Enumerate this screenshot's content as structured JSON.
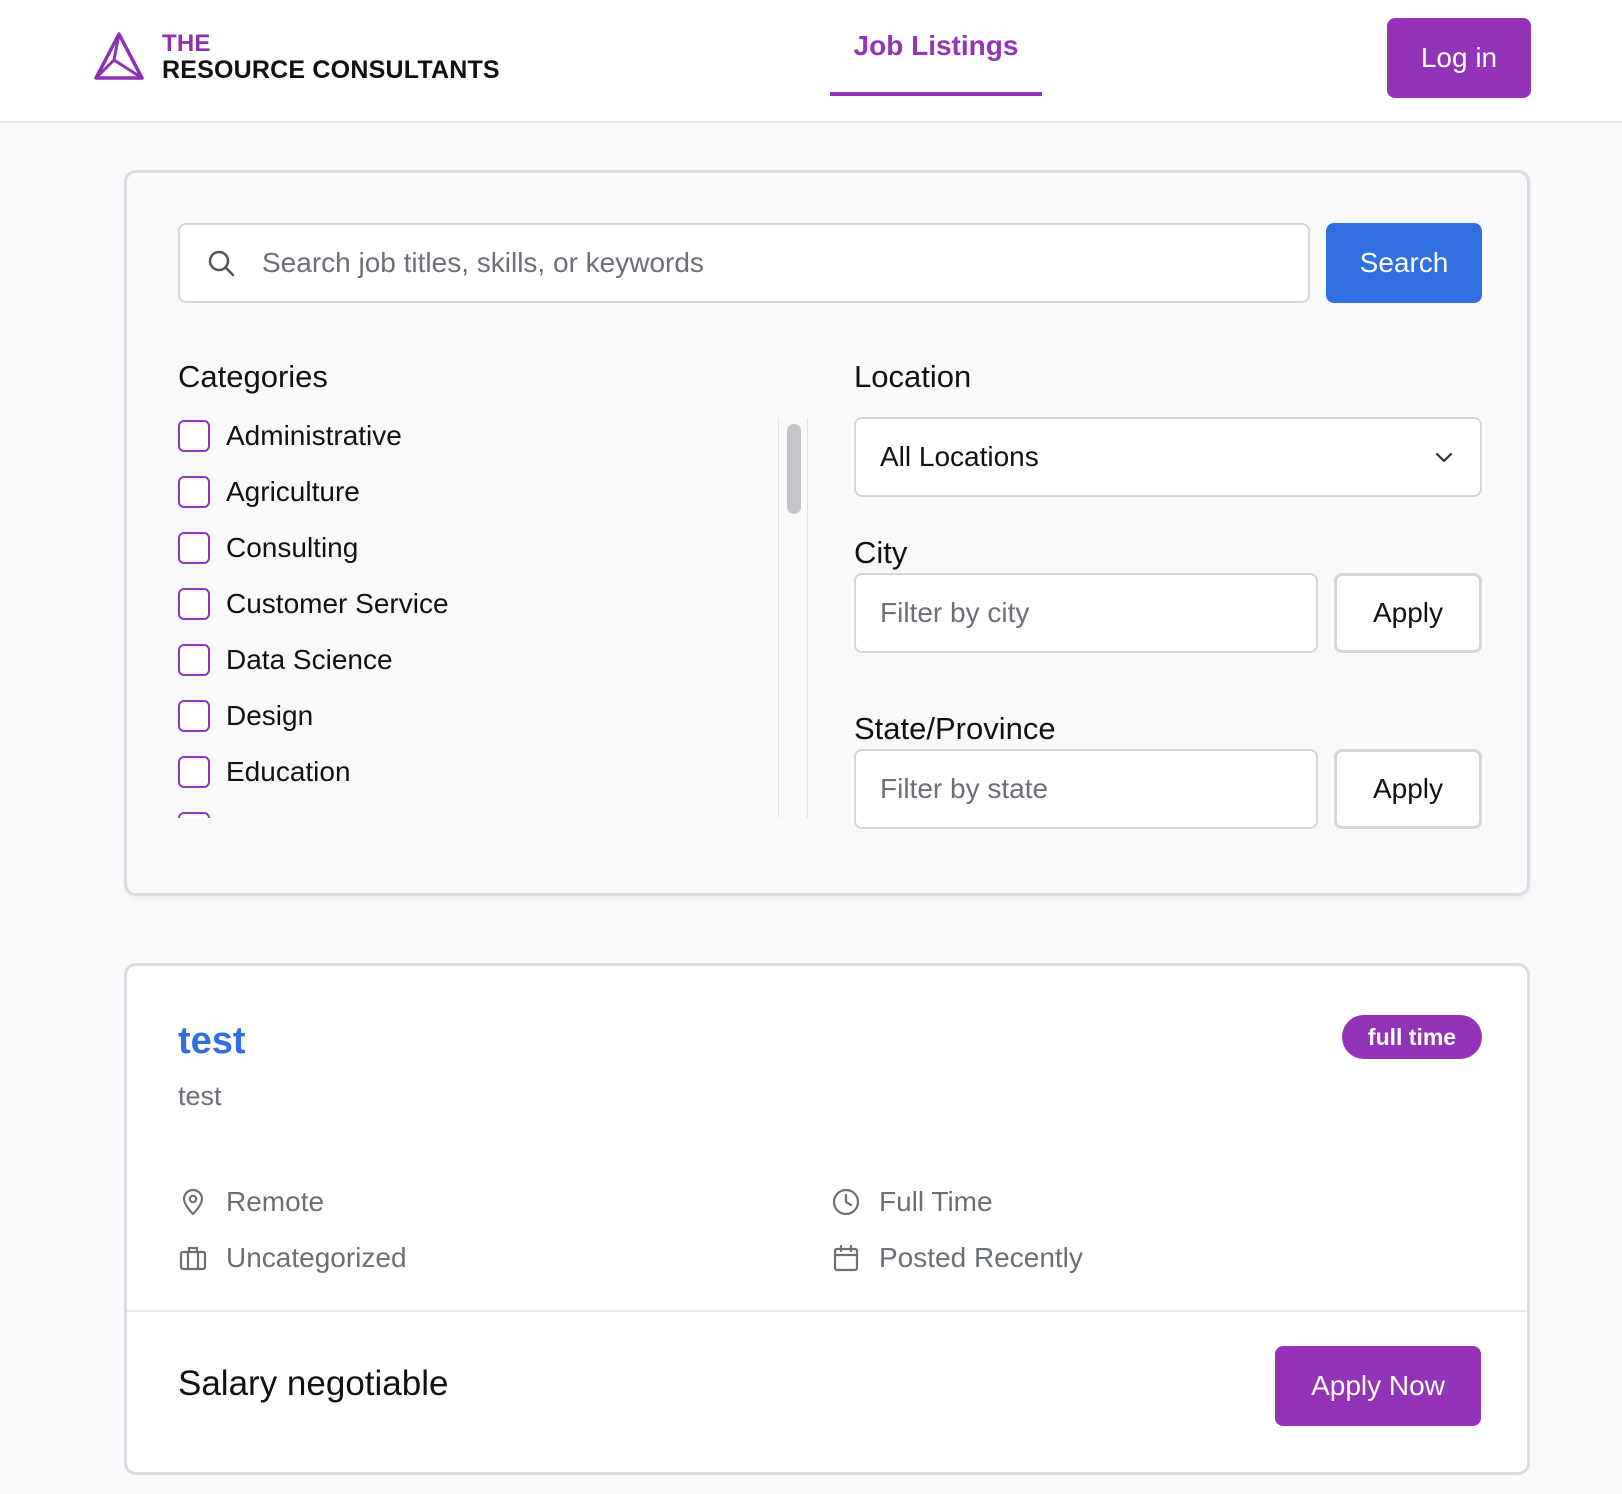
{
  "header": {
    "logo_line1": "THE",
    "logo_line2": "RESOURCE CONSULTANTS",
    "nav_tab": "Job Listings",
    "login_label": "Log in"
  },
  "search": {
    "placeholder": "Search job titles, skills, or keywords",
    "value": "",
    "button_label": "Search"
  },
  "filters": {
    "categories_title": "Categories",
    "categories": [
      {
        "label": "Administrative",
        "checked": false
      },
      {
        "label": "Agriculture",
        "checked": false
      },
      {
        "label": "Consulting",
        "checked": false
      },
      {
        "label": "Customer Service",
        "checked": false
      },
      {
        "label": "Data Science",
        "checked": false
      },
      {
        "label": "Design",
        "checked": false
      },
      {
        "label": "Education",
        "checked": false
      }
    ],
    "location_title": "Location",
    "location_selected": "All Locations",
    "city_title": "City",
    "city_placeholder": "Filter by city",
    "city_apply": "Apply",
    "state_title": "State/Province",
    "state_placeholder": "Filter by state",
    "state_apply": "Apply"
  },
  "job": {
    "title": "test",
    "company": "test",
    "badge": "full time",
    "location": "Remote",
    "type": "Full Time",
    "category": "Uncategorized",
    "posted": "Posted Recently",
    "salary": "Salary negotiable",
    "apply_label": "Apply Now"
  },
  "colors": {
    "brand_purple": "#9333b8",
    "primary_blue": "#2f6fdf"
  }
}
